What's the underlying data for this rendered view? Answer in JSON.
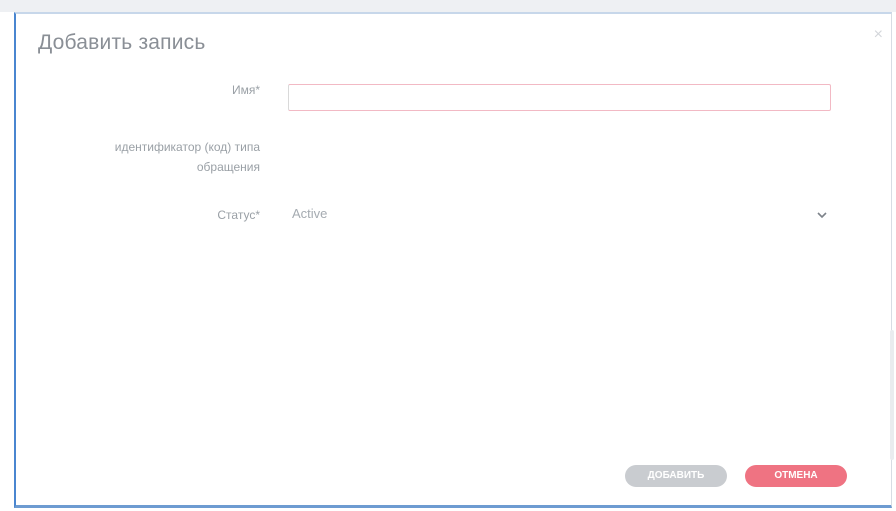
{
  "dialog": {
    "title": "Добавить запись",
    "close_symbol": "×"
  },
  "form": {
    "name_label": "Имя*",
    "name_value": "",
    "id_label_line1": "идентификатор (код) типа",
    "id_label_line2": "обращения",
    "status_label": "Статус*",
    "status_value": "Active"
  },
  "buttons": {
    "add_label": "ДОБАВИТЬ",
    "cancel_label": "ОТМЕНА"
  },
  "colors": {
    "accent": "#4a86d0",
    "cancel": "#ef7382",
    "disabled": "#c9ccd0",
    "invalid_border": "#f2b9c4"
  }
}
